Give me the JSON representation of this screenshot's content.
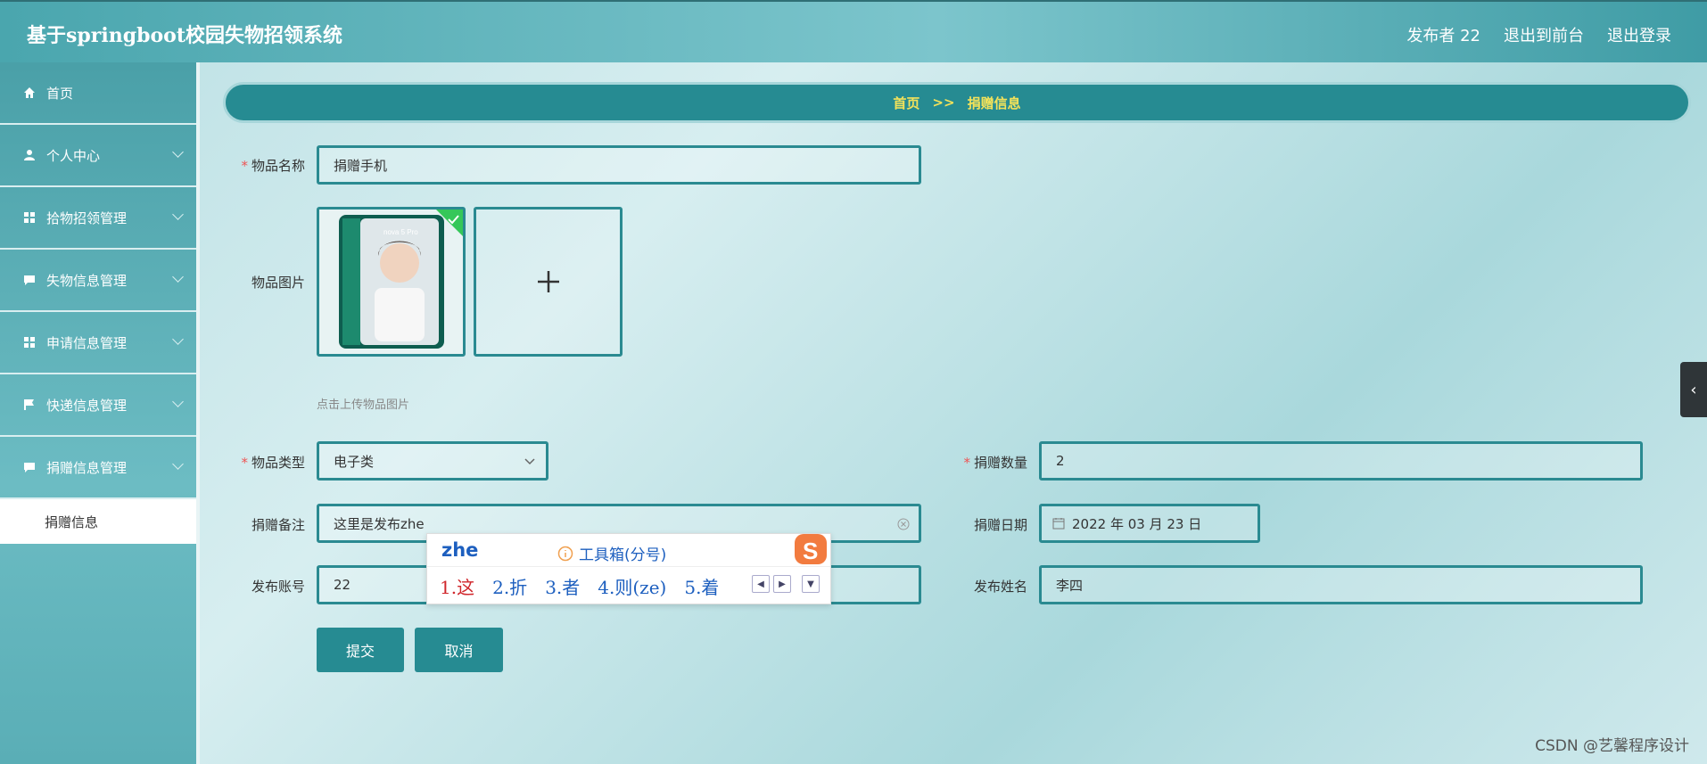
{
  "header": {
    "title": "基于springboot校园失物招领系统",
    "publisher": "发布者 22",
    "to_front": "退出到前台",
    "logout": "退出登录"
  },
  "sidebar": {
    "items": [
      {
        "label": "首页",
        "icon": "home-icon"
      },
      {
        "label": "个人中心",
        "icon": "user-icon"
      },
      {
        "label": "拾物招领管理",
        "icon": "grid-icon"
      },
      {
        "label": "失物信息管理",
        "icon": "chat-icon"
      },
      {
        "label": "申请信息管理",
        "icon": "grid-icon"
      },
      {
        "label": "快递信息管理",
        "icon": "flag-icon"
      },
      {
        "label": "捐赠信息管理",
        "icon": "chat-icon"
      }
    ],
    "sub_active": "捐赠信息"
  },
  "breadcrumb": {
    "home": "首页",
    "sep": ">>",
    "current": "捐赠信息"
  },
  "form": {
    "name_label": "物品名称",
    "name_value": "捐赠手机",
    "image_label": "物品图片",
    "image_hint": "点击上传物品图片",
    "type_label": "物品类型",
    "type_value": "电子类",
    "qty_label": "捐赠数量",
    "qty_value": "2",
    "note_label": "捐赠备注",
    "note_value": "这里是发布zhe",
    "date_label": "捐赠日期",
    "date_value": "2022 年 03 月 23 日",
    "account_label": "发布账号",
    "account_value": "22",
    "pubname_label": "发布姓名",
    "pubname_value": "李四",
    "submit": "提交",
    "cancel": "取消"
  },
  "ime": {
    "pinyin": "zhe",
    "toolbox": "工具箱(分号)",
    "candidates": [
      "1.这",
      "2.折",
      "3.者",
      "4.则(ze)",
      "5.着"
    ]
  },
  "phone_text": "nova 5 Pro",
  "watermark": "CSDN @艺馨程序设计",
  "colors": {
    "accent": "#268b92",
    "highlight": "#f3e25a"
  }
}
